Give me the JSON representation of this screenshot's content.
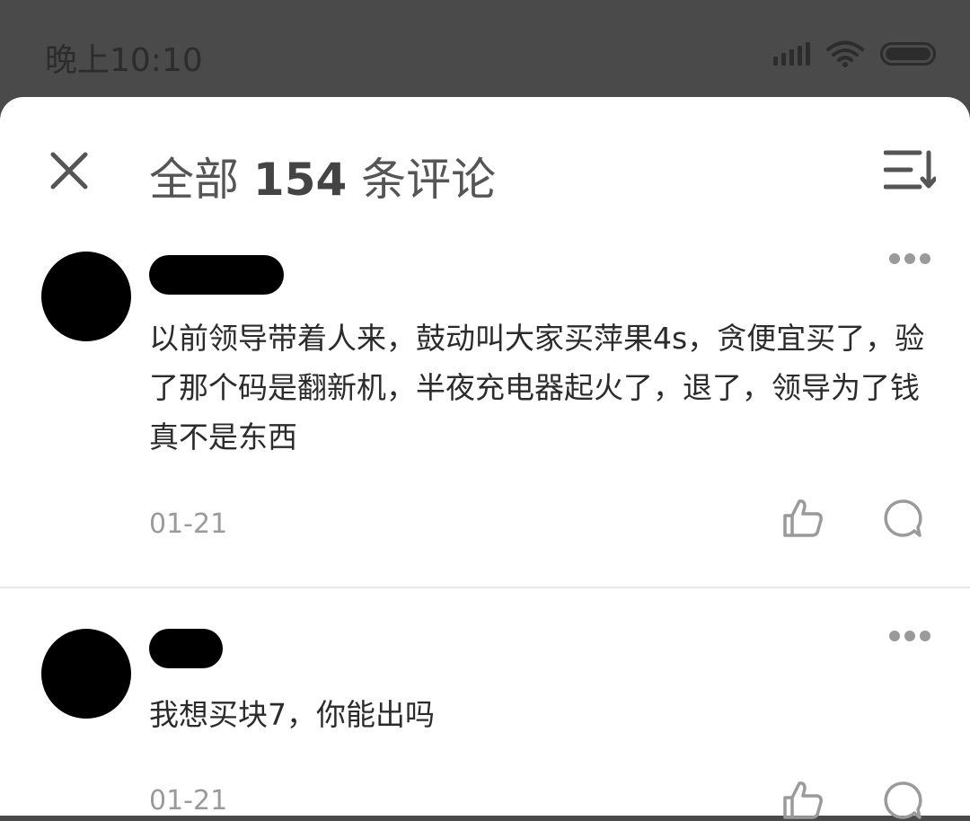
{
  "status_bar": {
    "time": "晚上10:10",
    "icons": [
      "signal-icon",
      "wifi-icon",
      "battery-icon"
    ]
  },
  "header": {
    "title_prefix": "全部 ",
    "count": "154",
    "title_suffix": " 条评论",
    "close_icon": "close-icon",
    "sort_icon": "sort-icon"
  },
  "comments": [
    {
      "text": "以前领导带着人来，鼓动叫大家买萍果4s，贪便宜买了，验了那个码是翻新机，半夜充电器起火了，退了，领导为了钱真不是东西",
      "date": "01-21"
    },
    {
      "text": "我想买块7，你能出吗",
      "date": "01-21"
    }
  ]
}
